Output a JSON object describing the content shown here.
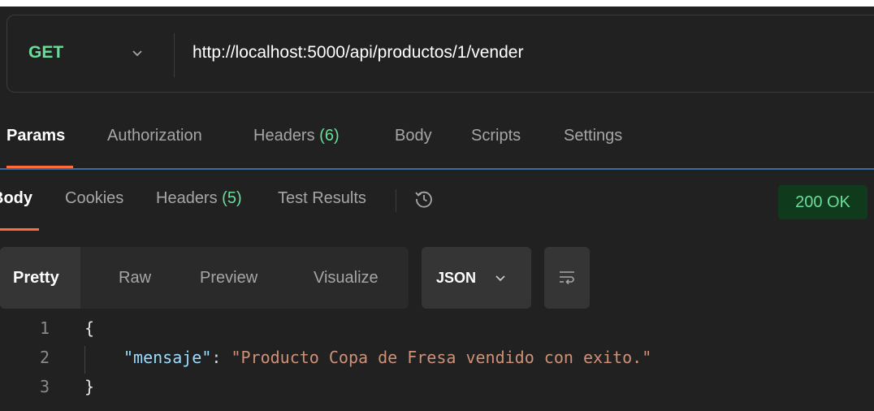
{
  "request": {
    "method": "GET",
    "url": "http://localhost:5000/api/productos/1/vender"
  },
  "request_tabs": {
    "params": "Params",
    "authorization": "Authorization",
    "headers_label": "Headers",
    "headers_count": "(6)",
    "body": "Body",
    "scripts": "Scripts",
    "settings": "Settings"
  },
  "response_tabs": {
    "body": "Body",
    "cookies": "Cookies",
    "headers_label": "Headers",
    "headers_count": "(5)",
    "test_results": "Test Results",
    "status": "200 OK"
  },
  "view": {
    "pretty": "Pretty",
    "raw": "Raw",
    "preview": "Preview",
    "visualize": "Visualize",
    "format": "JSON"
  },
  "response_body": {
    "line_numbers": [
      "1",
      "2",
      "3"
    ],
    "open_brace": "{",
    "close_brace": "}",
    "key": "\"mensaje\"",
    "colon": ": ",
    "value": "\"Producto Copa de Fresa vendido con exito.\""
  },
  "colors": {
    "method": "#6bdd9a",
    "accent": "#ff6c37",
    "status_bg": "#0f3a1c",
    "status_text": "#6bdd9a"
  },
  "icons": [
    "chevron-down-icon",
    "history-icon",
    "wrap-lines-icon"
  ]
}
